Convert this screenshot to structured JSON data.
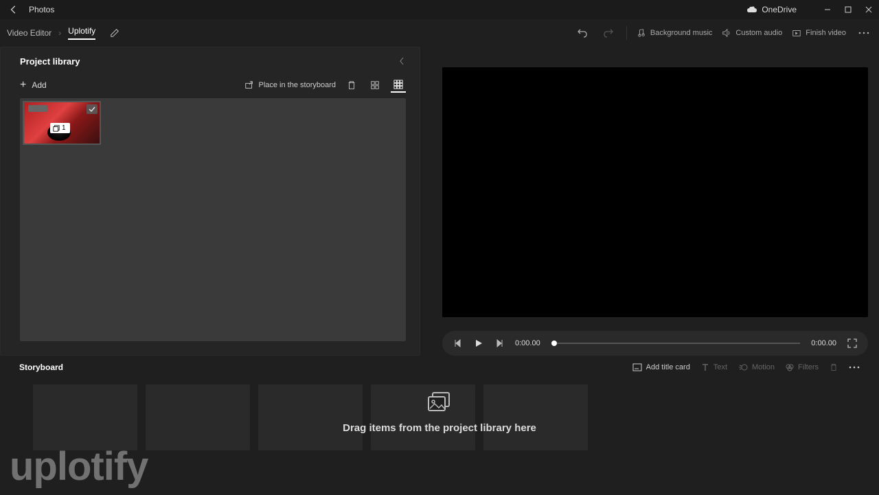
{
  "titlebar": {
    "app": "Photos",
    "onedrive": "OneDrive"
  },
  "breadcrumb": {
    "root": "Video Editor",
    "project": "Uplotify"
  },
  "toolbar": {
    "bg_music": "Background music",
    "custom_audio": "Custom audio",
    "finish_video": "Finish video"
  },
  "library": {
    "title": "Project library",
    "add": "Add",
    "place": "Place in the storyboard",
    "thumb_count": "1"
  },
  "player": {
    "current_time": "0:00.00",
    "total_time": "0:00.00"
  },
  "storyboard": {
    "title": "Storyboard",
    "add_title_card": "Add title card",
    "text": "Text",
    "motion": "Motion",
    "filters": "Filters",
    "hint": "Drag items from the project library here"
  },
  "watermark": "uplotify"
}
